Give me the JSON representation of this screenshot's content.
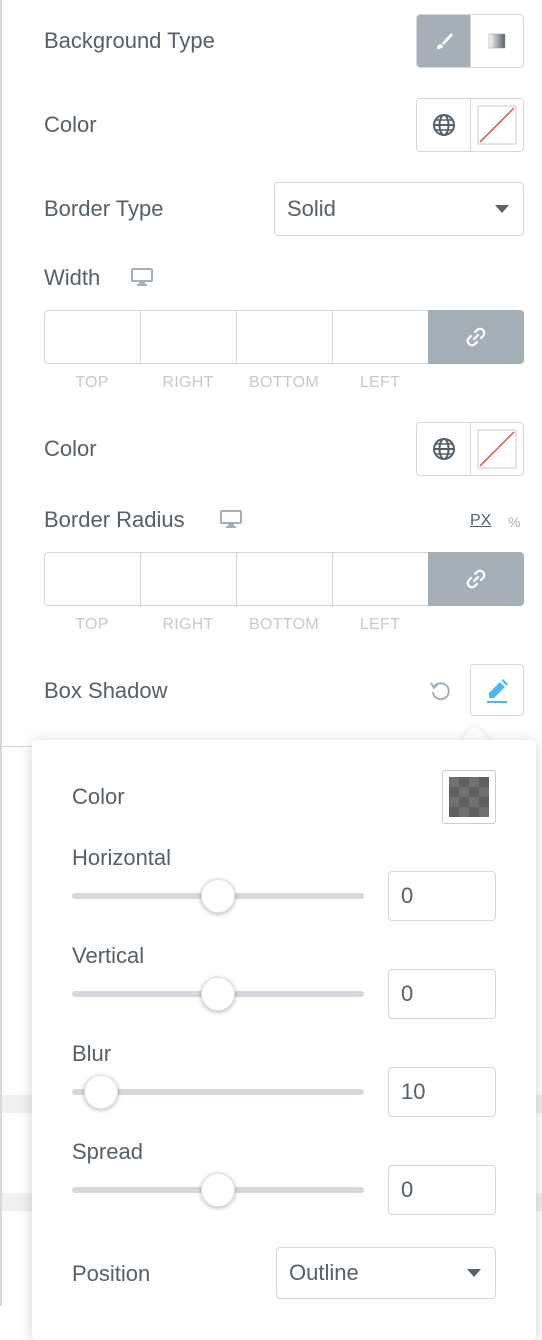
{
  "background_type": {
    "label": "Background Type",
    "options": [
      "classic-brush-icon",
      "gradient-icon"
    ],
    "active": 0
  },
  "color": {
    "label": "Color"
  },
  "border_type": {
    "label": "Border Type",
    "value": "Solid"
  },
  "width": {
    "label": "Width",
    "sides": [
      "TOP",
      "RIGHT",
      "BOTTOM",
      "LEFT"
    ]
  },
  "border_color": {
    "label": "Color"
  },
  "border_radius": {
    "label": "Border Radius",
    "units": [
      "PX",
      "%"
    ],
    "active_unit": "PX",
    "sides": [
      "TOP",
      "RIGHT",
      "BOTTOM",
      "LEFT"
    ]
  },
  "box_shadow": {
    "label": "Box Shadow",
    "popover": {
      "color_label": "Color",
      "swatch_color": "#6b6b6b",
      "sliders": [
        {
          "label": "Horizontal",
          "value": "0",
          "level": 0.5
        },
        {
          "label": "Vertical",
          "value": "0",
          "level": 0.5
        },
        {
          "label": "Blur",
          "value": "10",
          "level": 0.1
        },
        {
          "label": "Spread",
          "value": "0",
          "level": 0.5
        }
      ],
      "position": {
        "label": "Position",
        "value": "Outline"
      }
    }
  },
  "colors": {
    "accent": "#a4afb7",
    "text": "#556068",
    "edit_icon": "#4ab7f4",
    "none_slash": "#e74c3c"
  }
}
